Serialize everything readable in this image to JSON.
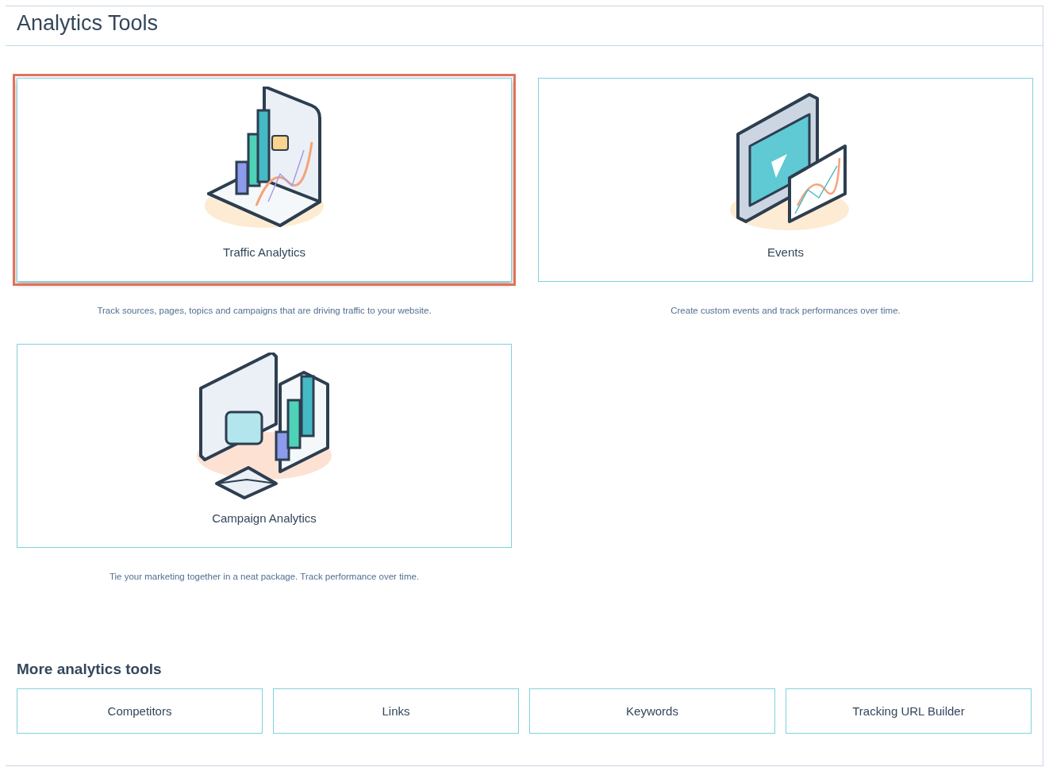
{
  "page": {
    "title": "Analytics Tools"
  },
  "tools": [
    {
      "kind": "traffic",
      "name": "Traffic Analytics",
      "description": "Track sources, pages, topics and campaigns that are driving traffic to your website.",
      "highlighted": true
    },
    {
      "kind": "events",
      "name": "Events",
      "description": "Create custom events and track performances over time.",
      "highlighted": false
    },
    {
      "kind": "campaign",
      "name": "Campaign Analytics",
      "description": "Tie your marketing together in a neat package. Track performance over time.",
      "highlighted": false
    }
  ],
  "more_tools": {
    "heading": "More analytics tools",
    "buttons": [
      "Competitors",
      "Links",
      "Keywords",
      "Tracking URL Builder"
    ]
  }
}
